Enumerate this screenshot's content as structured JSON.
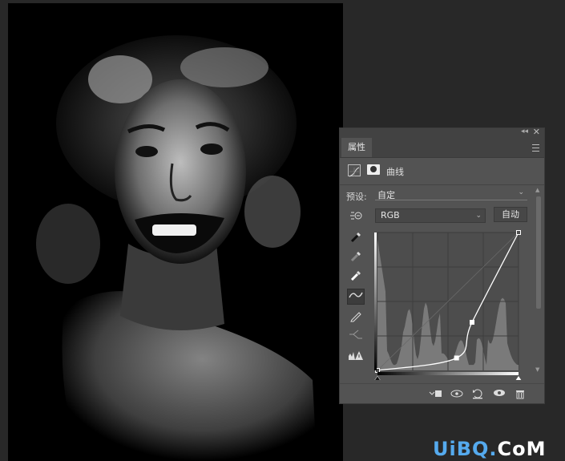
{
  "panel": {
    "tab_label": "属性",
    "adjustment_title": "曲线",
    "preset_label": "预设:",
    "preset_value": "自定",
    "channel_value": "RGB",
    "auto_label": "自动"
  },
  "curve": {
    "input_range": [
      0,
      255
    ],
    "output_range": [
      0,
      255
    ],
    "points": [
      [
        0,
        0
      ],
      [
        143,
        23
      ],
      [
        171,
        89
      ],
      [
        255,
        255
      ]
    ]
  },
  "watermark": {
    "part1": "UiBQ.",
    "part2": "CoM"
  },
  "icons": {
    "sample_black": "eyedropper-black-icon",
    "sample_gray": "eyedropper-gray-icon",
    "sample_white": "eyedropper-white-icon",
    "edit_points": "curve-points-icon",
    "draw": "pencil-icon",
    "smooth": "smooth-icon",
    "clip": "clip-to-layer-icon",
    "view_prev": "view-previous-icon",
    "reset": "reset-icon",
    "visibility": "eye-icon",
    "delete": "trash-icon"
  }
}
